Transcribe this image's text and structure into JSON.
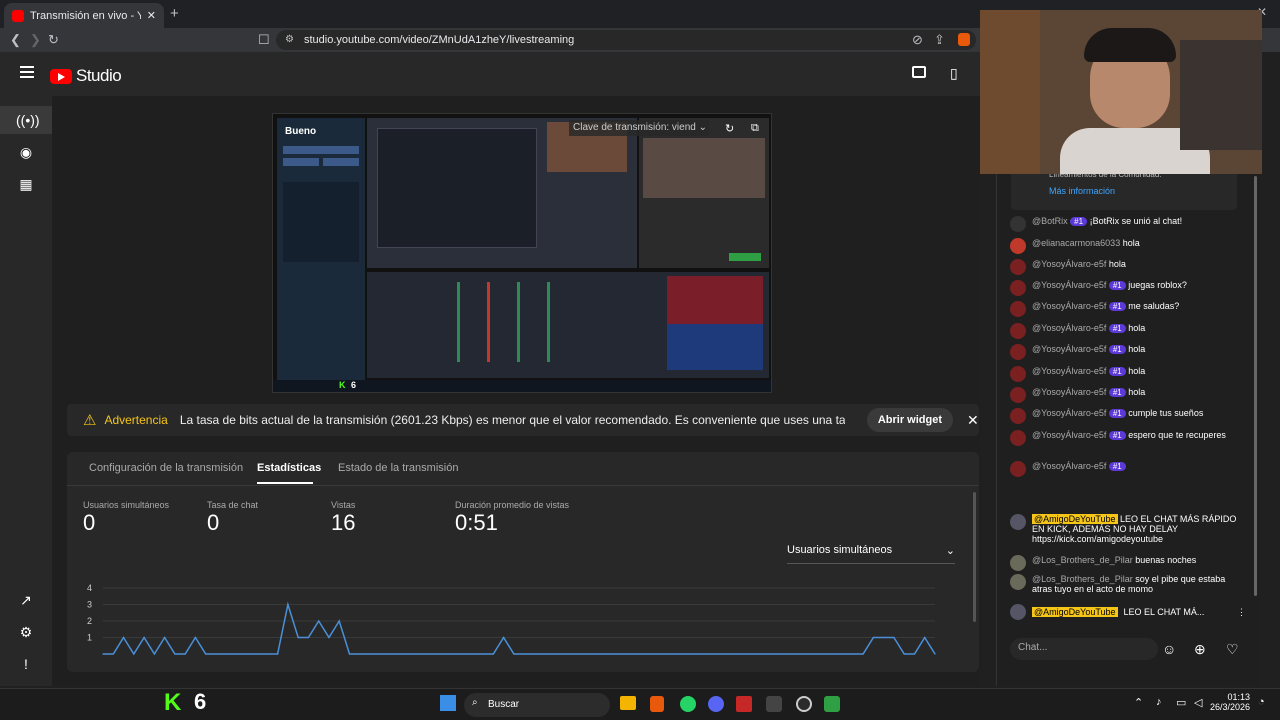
{
  "browser": {
    "tab_title": "Transmisión en vivo - YouTube",
    "url": "studio.youtube.com/video/ZMnUdA1zheY/livestreaming"
  },
  "studio": {
    "logo_text": "Studio"
  },
  "preview": {
    "stream_key_label": "Clave de transmisión: viend",
    "obs_heading": "Bueno",
    "kick_count": "6"
  },
  "warning": {
    "label": "Advertencia",
    "text": "La tasa de bits actual de la transmisión (2601.23 Kbps) es menor que el valor recomendado. Es conveniente que uses una tasa de bits de ...",
    "button": "Abrir widget"
  },
  "tabs": [
    {
      "label": "Configuración de la transmisión"
    },
    {
      "label": "Estadísticas"
    },
    {
      "label": "Estado de la transmisión"
    }
  ],
  "stats": [
    {
      "label": "Usuarios simultáneos",
      "value": "0"
    },
    {
      "label": "Tasa de chat",
      "value": "0"
    },
    {
      "label": "Vistas",
      "value": "16"
    },
    {
      "label": "Duración promedio de vistas",
      "value": "0:51"
    }
  ],
  "chart_select": "Usuarios simultáneos",
  "chart_data": {
    "type": "line",
    "y_ticks": [
      "4",
      "3",
      "2",
      "1"
    ],
    "ylim": [
      0,
      4
    ],
    "values": [
      0,
      0,
      1,
      0,
      1,
      0,
      1,
      0,
      0,
      1,
      0,
      0,
      0,
      0,
      0,
      0,
      0,
      0,
      3,
      1,
      1,
      2,
      1,
      2,
      0,
      0,
      0,
      0,
      0,
      0,
      0,
      0,
      0,
      0,
      0,
      0,
      0,
      0,
      0,
      1,
      0,
      0,
      0,
      0,
      0,
      0,
      0,
      0,
      0,
      0,
      0,
      0,
      0,
      0,
      0,
      0,
      0,
      0,
      0,
      0,
      0,
      0,
      0,
      0,
      0,
      0,
      0,
      0,
      0,
      0,
      0,
      0,
      0,
      0,
      0,
      1,
      1,
      1,
      0,
      0,
      1,
      0
    ]
  },
  "chat": {
    "guidelines_text": "Lineamientos de la Comunidad.",
    "more_info": "Más información",
    "messages": [
      {
        "name": "@BotRix",
        "badge": "#1",
        "text": "¡BotRix se unió al chat!"
      },
      {
        "name": "@elianacarmona6033",
        "badge": "",
        "text": "hola"
      },
      {
        "name": "@YosoyÁlvaro-e5f",
        "badge": "",
        "text": "hola"
      },
      {
        "name": "@YosoyÁlvaro-e5f",
        "badge": "#1",
        "text": "juegas roblox?"
      },
      {
        "name": "@YosoyÁlvaro-e5f",
        "badge": "#1",
        "text": "me saludas?"
      },
      {
        "name": "@YosoyÁlvaro-e5f",
        "badge": "#1",
        "text": "hola"
      },
      {
        "name": "@YosoyÁlvaro-e5f",
        "badge": "#1",
        "text": "hola"
      },
      {
        "name": "@YosoyÁlvaro-e5f",
        "badge": "#1",
        "text": "hola"
      },
      {
        "name": "@YosoyÁlvaro-e5f",
        "badge": "#1",
        "text": "hola"
      },
      {
        "name": "@YosoyÁlvaro-e5f",
        "badge": "#1",
        "text": "cumple tus sueños"
      },
      {
        "name": "@YosoyÁlvaro-e5f",
        "badge": "#1",
        "text": "espero que te recuperes"
      },
      {
        "name": "@YosoyÁlvaro-e5f",
        "badge": "#1",
        "text": ""
      },
      {
        "name": "@AmigoDeYouTube",
        "badge": "",
        "text": "LEO EL CHAT MÁS RÁPIDO EN KICK, ADEMÁS NO HAY DELAY https://kick.com/amigodeyoutube"
      },
      {
        "name": "@Los_Brothers_de_Pilar",
        "badge": "",
        "text": "buenas noches"
      },
      {
        "name": "@Los_Brothers_de_Pilar",
        "badge": "",
        "text": "soy el pibe que estaba atras tuyo en el acto de momo"
      }
    ],
    "pinned_name": "@AmigoDeYouTube",
    "pinned_text": "LEO EL CHAT MÁ...",
    "input_placeholder": "Chat..."
  },
  "taskbar": {
    "kick_count": "6",
    "search": "Buscar",
    "time": "01:13",
    "date": "26/3/2026"
  }
}
